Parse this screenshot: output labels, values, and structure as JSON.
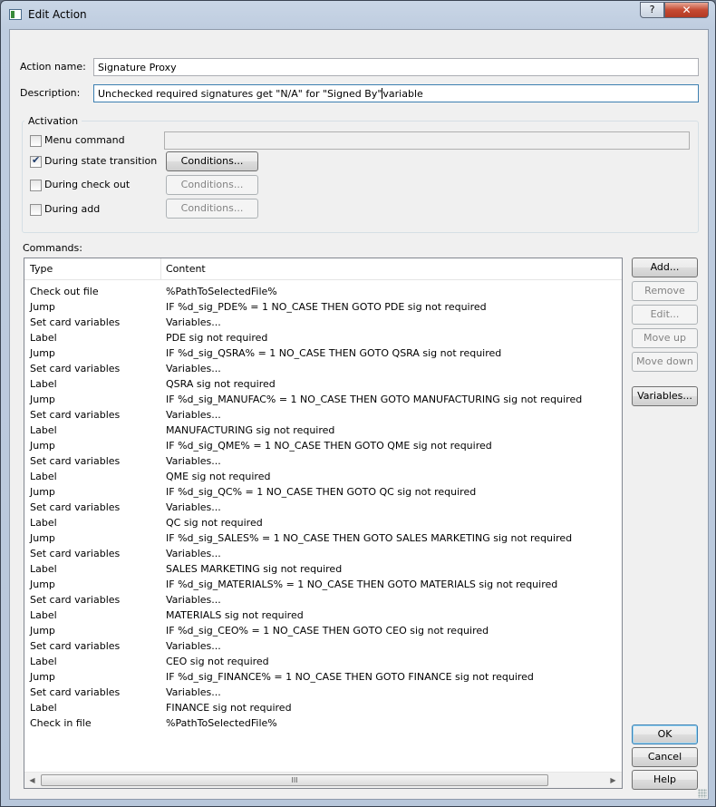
{
  "window": {
    "title": "Edit Action",
    "help_label": "?",
    "close_label": "✕"
  },
  "form": {
    "action_name_label": "Action name:",
    "action_name_value": "Signature Proxy",
    "description_label": "Description:",
    "description_value": "Unchecked required signatures get \"N/A\" for \"Signed By\"",
    "description_value_rest": "variable"
  },
  "activation": {
    "title": "Activation",
    "items": [
      {
        "label": "Menu command",
        "checked": false
      },
      {
        "label": "During state transition",
        "checked": true,
        "button": "Conditions...",
        "enabled": true
      },
      {
        "label": "During check out",
        "checked": false,
        "button": "Conditions...",
        "enabled": false
      },
      {
        "label": "During add",
        "checked": false,
        "button": "Conditions...",
        "enabled": false
      }
    ]
  },
  "commands": {
    "label": "Commands:",
    "columns": [
      "Type",
      "Content"
    ],
    "rows": [
      [
        "Check out file",
        "%PathToSelectedFile%"
      ],
      [
        "Jump",
        "IF %d_sig_PDE% = 1 NO_CASE THEN GOTO PDE sig not required"
      ],
      [
        "Set card variables",
        "Variables..."
      ],
      [
        "Label",
        "PDE sig not required"
      ],
      [
        "Jump",
        "IF %d_sig_QSRA% = 1 NO_CASE THEN GOTO QSRA sig not required"
      ],
      [
        "Set card variables",
        "Variables..."
      ],
      [
        "Label",
        "QSRA sig not required"
      ],
      [
        "Jump",
        "IF %d_sig_MANUFAC% = 1 NO_CASE THEN GOTO MANUFACTURING sig not required"
      ],
      [
        "Set card variables",
        "Variables..."
      ],
      [
        "Label",
        "MANUFACTURING sig not required"
      ],
      [
        "Jump",
        "IF %d_sig_QME% = 1 NO_CASE THEN GOTO QME sig not required"
      ],
      [
        "Set card variables",
        "Variables..."
      ],
      [
        "Label",
        "QME sig not required"
      ],
      [
        "Jump",
        "IF %d_sig_QC% = 1 NO_CASE THEN GOTO QC sig not required"
      ],
      [
        "Set card variables",
        "Variables..."
      ],
      [
        "Label",
        "QC sig not required"
      ],
      [
        "Jump",
        "IF %d_sig_SALES% = 1 NO_CASE THEN GOTO SALES MARKETING sig not required"
      ],
      [
        "Set card variables",
        "Variables..."
      ],
      [
        "Label",
        "SALES MARKETING sig not required"
      ],
      [
        "Jump",
        "IF %d_sig_MATERIALS% = 1 NO_CASE THEN GOTO MATERIALS sig not required"
      ],
      [
        "Set card variables",
        "Variables..."
      ],
      [
        "Label",
        "MATERIALS sig not required"
      ],
      [
        "Jump",
        "IF %d_sig_CEO% = 1 NO_CASE THEN GOTO CEO sig not required"
      ],
      [
        "Set card variables",
        "Variables..."
      ],
      [
        "Label",
        "CEO sig not required"
      ],
      [
        "Jump",
        "IF %d_sig_FINANCE% = 1 NO_CASE THEN GOTO FINANCE sig not required"
      ],
      [
        "Set card variables",
        "Variables..."
      ],
      [
        "Label",
        "FINANCE sig not required"
      ],
      [
        "Check in file",
        "%PathToSelectedFile%"
      ]
    ],
    "scroll_thumb": "III"
  },
  "side_buttons": {
    "add": "Add...",
    "remove": "Remove",
    "edit": "Edit...",
    "move_up": "Move up",
    "move_down": "Move down",
    "variables": "Variables..."
  },
  "dialog_buttons": {
    "ok": "OK",
    "cancel": "Cancel",
    "help": "Help"
  }
}
